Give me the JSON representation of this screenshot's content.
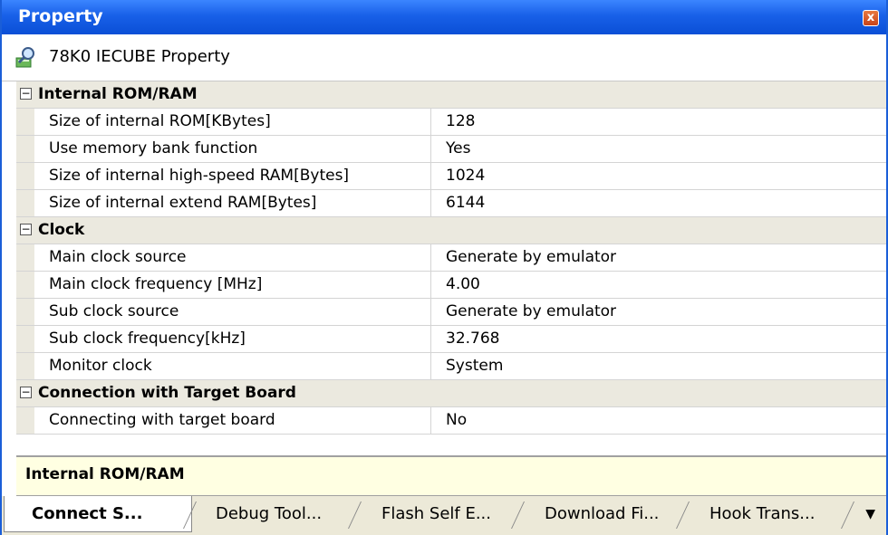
{
  "window": {
    "title": "Property",
    "close_label": "x"
  },
  "header": {
    "icon": "property-magnifier-icon",
    "label": "78K0 IECUBE Property"
  },
  "categories": [
    {
      "label": "Internal ROM/RAM",
      "rows": [
        {
          "name": "Size of internal ROM[KBytes]",
          "value": "128"
        },
        {
          "name": "Use memory bank function",
          "value": "Yes"
        },
        {
          "name": "Size of internal high-speed RAM[Bytes]",
          "value": "1024"
        },
        {
          "name": "Size of internal extend RAM[Bytes]",
          "value": "6144"
        }
      ]
    },
    {
      "label": "Clock",
      "rows": [
        {
          "name": "Main clock source",
          "value": "Generate by emulator"
        },
        {
          "name": "Main clock frequency [MHz]",
          "value": "4.00"
        },
        {
          "name": "Sub clock source",
          "value": "Generate by emulator"
        },
        {
          "name": "Sub clock frequency[kHz]",
          "value": "32.768"
        },
        {
          "name": "Monitor clock",
          "value": "System"
        }
      ]
    },
    {
      "label": "Connection with Target Board",
      "rows": [
        {
          "name": "Connecting with target board",
          "value": "No"
        }
      ]
    }
  ],
  "collapse_symbol": "−",
  "description": {
    "text": "Internal ROM/RAM"
  },
  "tabs": [
    {
      "label": "Connect S...",
      "active": true
    },
    {
      "label": "Debug Tool...",
      "active": false
    },
    {
      "label": "Flash Self E...",
      "active": false
    },
    {
      "label": "Download Fi...",
      "active": false
    },
    {
      "label": "Hook Trans...",
      "active": false
    }
  ],
  "overflow_symbol": "▼"
}
